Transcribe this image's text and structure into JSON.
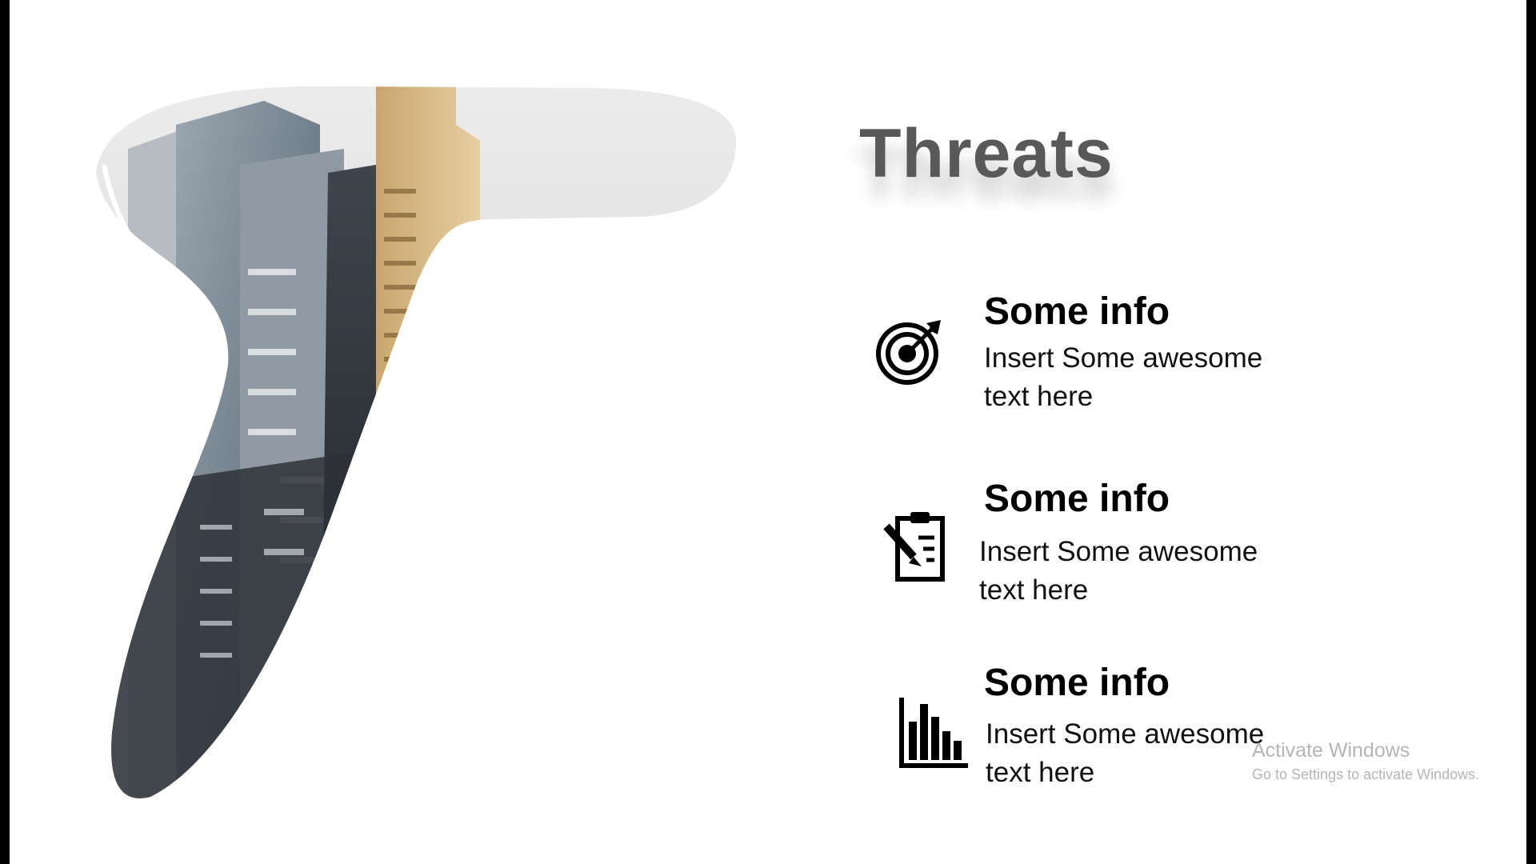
{
  "slide": {
    "title": "Threats",
    "background_color": "#ffffff",
    "image_description_icon": "city-buildings-letter-t-image",
    "items": [
      {
        "icon": "target-icon",
        "heading": "Some info",
        "text": "Insert Some awesome\ntext here"
      },
      {
        "icon": "clipboard-pencil-icon",
        "heading": "Some info",
        "text": "Insert Some awesome\ntext here"
      },
      {
        "icon": "bar-chart-icon",
        "heading": "Some info",
        "text": "Insert Some awesome\ntext here"
      }
    ]
  },
  "watermark": {
    "title": "Activate Windows",
    "subtitle": "Go to Settings to activate Windows."
  },
  "colors": {
    "title": "#595959",
    "text": "#000000",
    "watermark": "#b5b5b5",
    "frame": "#000000"
  }
}
